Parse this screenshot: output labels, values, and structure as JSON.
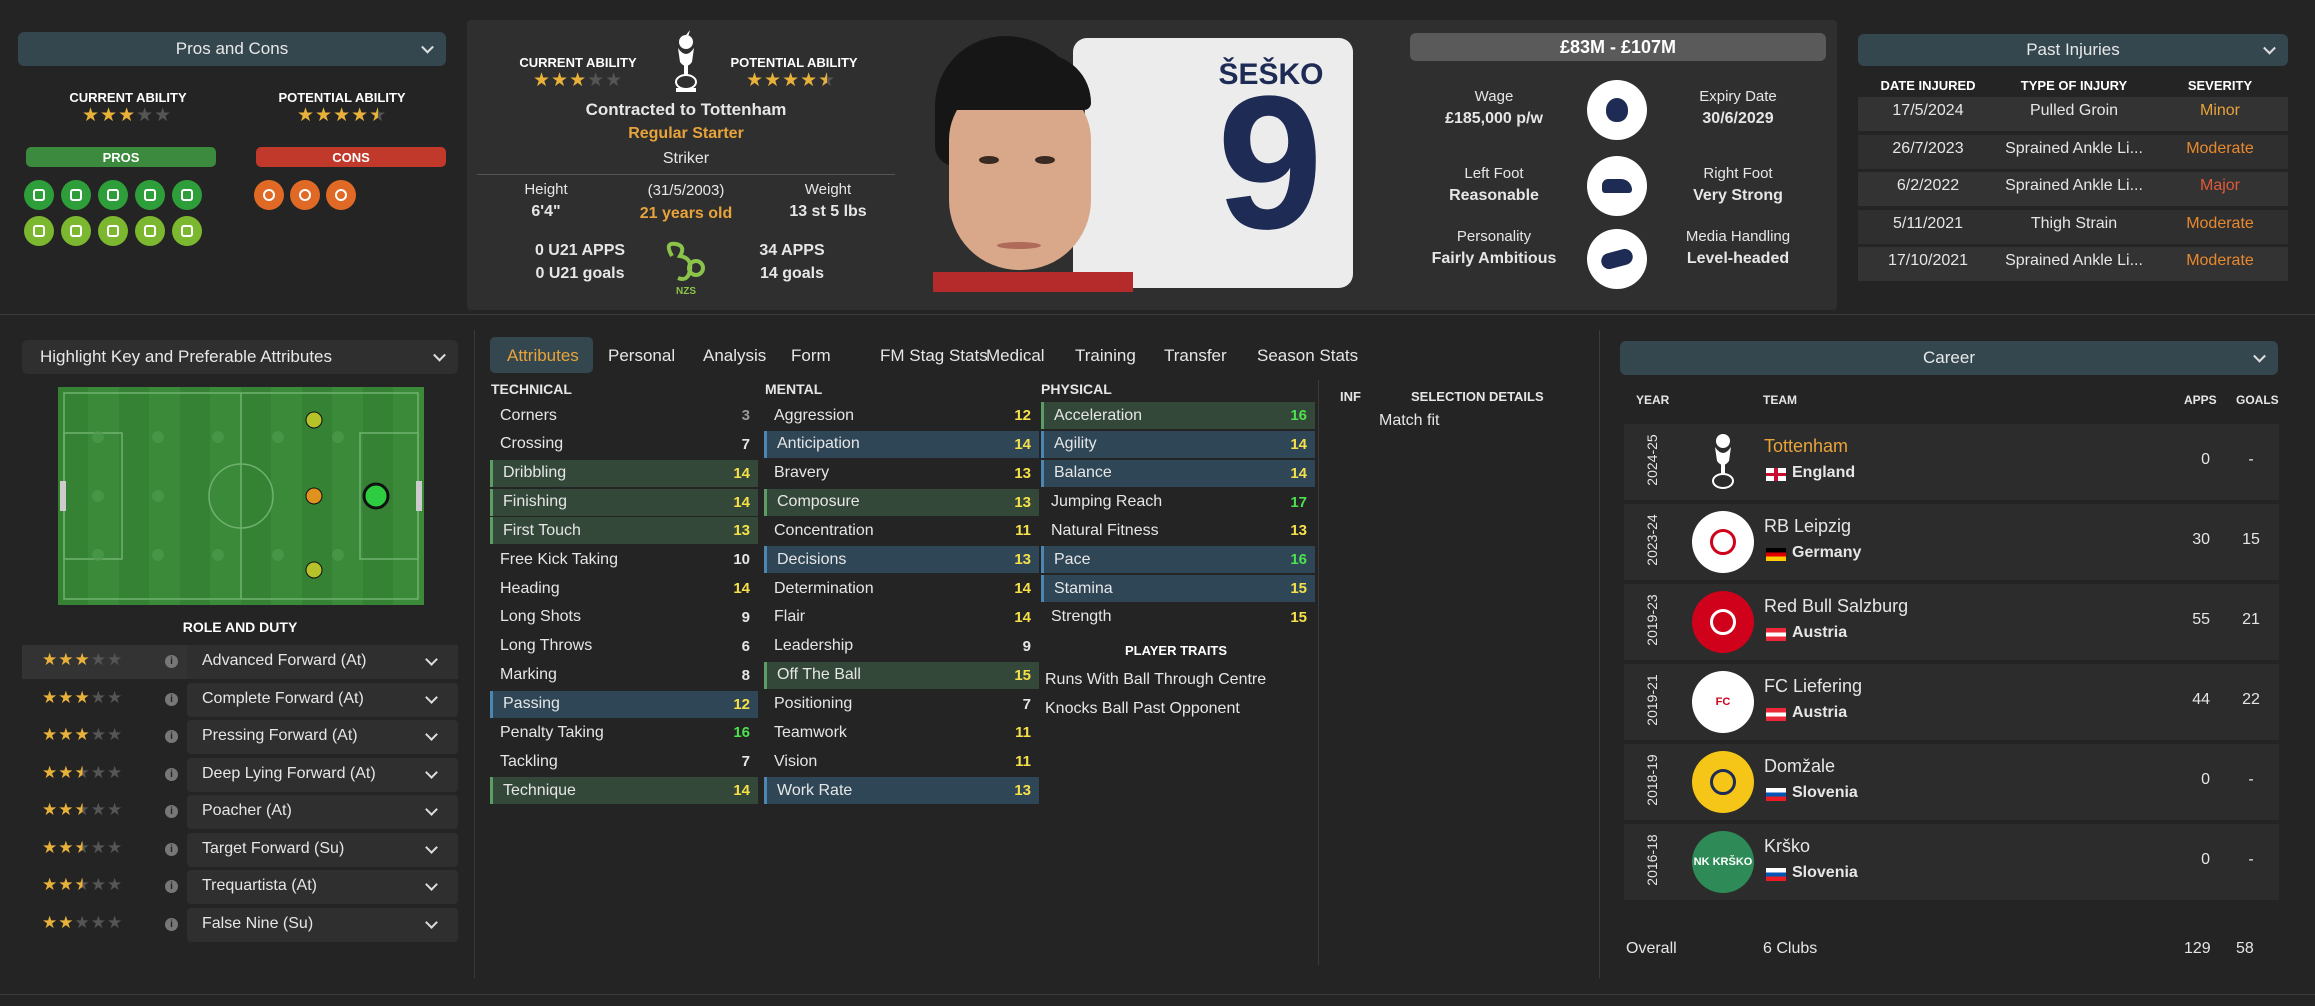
{
  "left": {
    "pros_cons_label": "Pros and Cons",
    "current_ability_label": "CURRENT ABILITY",
    "potential_ability_label": "POTENTIAL ABILITY",
    "current_ability_stars": 3,
    "potential_ability_stars": 4.5,
    "pros_label": "PROS",
    "cons_label": "CONS",
    "pros_icons": [
      "flag-icon",
      "medal-icon",
      "chart-icon",
      "star-icon",
      "bandage-icon",
      "wave-icon",
      "trend-icon",
      "brain-icon",
      "target-icon",
      "running-icon"
    ],
    "cons_icons": [
      "swirl-icon",
      "cone-icon",
      "flask-icon"
    ],
    "highlight_label": "Highlight Key and Preferable Attributes",
    "role_duty_label": "ROLE AND DUTY",
    "roles": [
      {
        "name": "Advanced Forward (At)",
        "stars": 3
      },
      {
        "name": "Complete Forward (At)",
        "stars": 3
      },
      {
        "name": "Pressing Forward (At)",
        "stars": 3
      },
      {
        "name": "Deep Lying Forward (At)",
        "stars": 2.5
      },
      {
        "name": "Poacher (At)",
        "stars": 2.5
      },
      {
        "name": "Target Forward (Su)",
        "stars": 2.5
      },
      {
        "name": "Trequartista (At)",
        "stars": 2.5
      },
      {
        "name": "False Nine (Su)",
        "stars": 2
      }
    ]
  },
  "profile": {
    "current_ability_label": "CURRENT ABILITY",
    "potential_ability_label": "POTENTIAL ABILITY",
    "contract": "Contracted to Tottenham",
    "status": "Regular Starter",
    "position": "Striker",
    "height_label": "Height",
    "height": "6'4\"",
    "dob": "(31/5/2003)",
    "age": "21 years old",
    "weight_label": "Weight",
    "weight": "13 st 5 lbs",
    "u21_apps": "0 U21 APPS",
    "u21_goals": "0 U21 goals",
    "apps": "34 APPS",
    "goals": "14 goals",
    "nation_badge": "NZS",
    "shirt_name": "ŠEŠKO",
    "shirt_number": "9"
  },
  "finance": {
    "value": "£83M - £107M",
    "wage_label": "Wage",
    "wage": "£185,000 p/w",
    "expiry_label": "Expiry Date",
    "expiry": "30/6/2029",
    "left_foot_label": "Left Foot",
    "left_foot": "Reasonable",
    "right_foot_label": "Right Foot",
    "right_foot": "Very Strong",
    "personality_label": "Personality",
    "personality": "Fairly Ambitious",
    "media_label": "Media Handling",
    "media": "Level-headed"
  },
  "injuries": {
    "label": "Past Injuries",
    "headers": [
      "DATE INJURED",
      "TYPE OF INJURY",
      "SEVERITY"
    ],
    "rows": [
      {
        "date": "17/5/2024",
        "type": "Pulled Groin",
        "severity": "Minor",
        "color": "#e8a33a"
      },
      {
        "date": "26/7/2023",
        "type": "Sprained Ankle Li...",
        "severity": "Moderate",
        "color": "#e8892e"
      },
      {
        "date": "6/2/2022",
        "type": "Sprained Ankle Li...",
        "severity": "Major",
        "color": "#e05a3a"
      },
      {
        "date": "5/11/2021",
        "type": "Thigh Strain",
        "severity": "Moderate",
        "color": "#e8892e"
      },
      {
        "date": "17/10/2021",
        "type": "Sprained Ankle Li...",
        "severity": "Moderate",
        "color": "#e8892e"
      }
    ]
  },
  "tabs": [
    "Attributes",
    "Personal",
    "Analysis",
    "Form",
    "FM Stag Stats",
    "Medical",
    "Training",
    "Transfer",
    "Season Stats"
  ],
  "technical": {
    "label": "TECHNICAL",
    "items": [
      {
        "n": "Corners",
        "v": "3",
        "h": ""
      },
      {
        "n": "Crossing",
        "v": "7",
        "h": ""
      },
      {
        "n": "Dribbling",
        "v": "14",
        "h": "g"
      },
      {
        "n": "Finishing",
        "v": "14",
        "h": "g"
      },
      {
        "n": "First Touch",
        "v": "13",
        "h": "g"
      },
      {
        "n": "Free Kick Taking",
        "v": "10",
        "h": ""
      },
      {
        "n": "Heading",
        "v": "14",
        "h": ""
      },
      {
        "n": "Long Shots",
        "v": "9",
        "h": ""
      },
      {
        "n": "Long Throws",
        "v": "6",
        "h": ""
      },
      {
        "n": "Marking",
        "v": "8",
        "h": ""
      },
      {
        "n": "Passing",
        "v": "12",
        "h": "b"
      },
      {
        "n": "Penalty Taking",
        "v": "16",
        "h": ""
      },
      {
        "n": "Tackling",
        "v": "7",
        "h": ""
      },
      {
        "n": "Technique",
        "v": "14",
        "h": "g"
      }
    ]
  },
  "mental": {
    "label": "MENTAL",
    "items": [
      {
        "n": "Aggression",
        "v": "12",
        "h": ""
      },
      {
        "n": "Anticipation",
        "v": "14",
        "h": "b"
      },
      {
        "n": "Bravery",
        "v": "13",
        "h": ""
      },
      {
        "n": "Composure",
        "v": "13",
        "h": "g"
      },
      {
        "n": "Concentration",
        "v": "11",
        "h": ""
      },
      {
        "n": "Decisions",
        "v": "13",
        "h": "b"
      },
      {
        "n": "Determination",
        "v": "14",
        "h": ""
      },
      {
        "n": "Flair",
        "v": "14",
        "h": ""
      },
      {
        "n": "Leadership",
        "v": "9",
        "h": ""
      },
      {
        "n": "Off The Ball",
        "v": "15",
        "h": "g"
      },
      {
        "n": "Positioning",
        "v": "7",
        "h": ""
      },
      {
        "n": "Teamwork",
        "v": "11",
        "h": ""
      },
      {
        "n": "Vision",
        "v": "11",
        "h": ""
      },
      {
        "n": "Work Rate",
        "v": "13",
        "h": "b"
      }
    ]
  },
  "physical": {
    "label": "PHYSICAL",
    "items": [
      {
        "n": "Acceleration",
        "v": "16",
        "h": "g"
      },
      {
        "n": "Agility",
        "v": "14",
        "h": "b"
      },
      {
        "n": "Balance",
        "v": "14",
        "h": "b"
      },
      {
        "n": "Jumping Reach",
        "v": "17",
        "h": ""
      },
      {
        "n": "Natural Fitness",
        "v": "13",
        "h": ""
      },
      {
        "n": "Pace",
        "v": "16",
        "h": "b"
      },
      {
        "n": "Stamina",
        "v": "15",
        "h": "b"
      },
      {
        "n": "Strength",
        "v": "15",
        "h": ""
      }
    ]
  },
  "traits": {
    "label": "PLAYER TRAITS",
    "items": [
      "Runs With Ball Through Centre",
      "Knocks Ball Past Opponent"
    ]
  },
  "selection": {
    "inf_label": "INF",
    "label": "SELECTION DETAILS",
    "value": "Match fit"
  },
  "career": {
    "label": "Career",
    "headers": {
      "year": "YEAR",
      "team": "TEAM",
      "apps": "APPS",
      "goals": "GOALS"
    },
    "rows": [
      {
        "year": "2024-25",
        "team": "Tottenham",
        "country": "England",
        "apps": "0",
        "goals": "-",
        "highlight": true
      },
      {
        "year": "2023-24",
        "team": "RB Leipzig",
        "country": "Germany",
        "apps": "30",
        "goals": "15",
        "highlight": false
      },
      {
        "year": "2019-23",
        "team": "Red Bull Salzburg",
        "country": "Austria",
        "apps": "55",
        "goals": "21",
        "highlight": false
      },
      {
        "year": "2019-21",
        "team": "FC Liefering",
        "country": "Austria",
        "apps": "44",
        "goals": "22",
        "highlight": false
      },
      {
        "year": "2018-19",
        "team": "Domžale",
        "country": "Slovenia",
        "apps": "0",
        "goals": "-",
        "highlight": false
      },
      {
        "year": "2016-18",
        "team": "Krško",
        "country": "Slovenia",
        "apps": "0",
        "goals": "-",
        "highlight": false
      }
    ],
    "overall_label": "Overall",
    "overall_clubs": "6 Clubs",
    "overall_apps": "129",
    "overall_goals": "58",
    "crest_labels": {
      "fc": "FC",
      "nk": "NK KRŠKO"
    }
  },
  "colors": {
    "accent": "#e8a33a",
    "green": "#4caf50",
    "yellow": "#f5e04a"
  }
}
